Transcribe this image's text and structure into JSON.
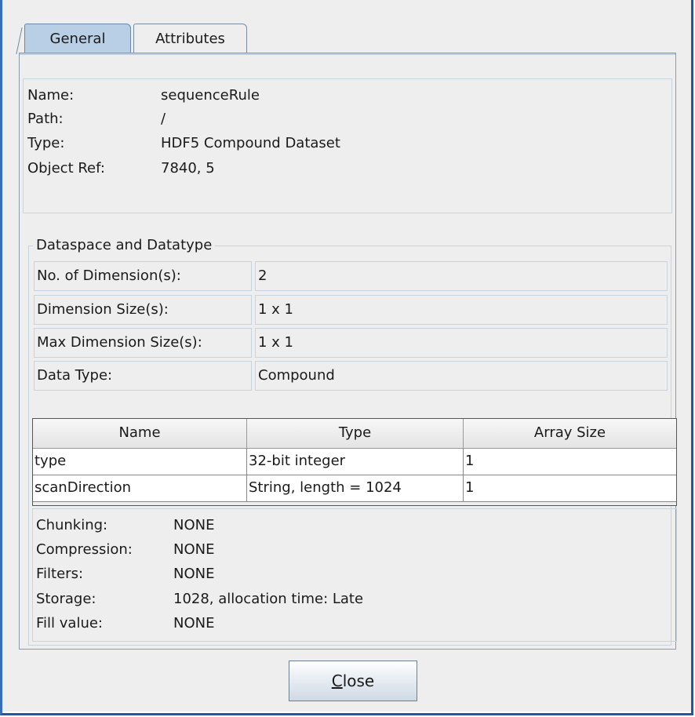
{
  "tabs": [
    {
      "label": "General",
      "selected": true
    },
    {
      "label": "Attributes",
      "selected": false
    }
  ],
  "general": {
    "name_label": "Name:",
    "name_value": "sequenceRule",
    "path_label": "Path:",
    "path_value": "/",
    "type_label": "Type:",
    "type_value": "HDF5 Compound Dataset",
    "ref_label": "Object Ref:",
    "ref_value": "7840, 5"
  },
  "dataspace": {
    "title": "Dataspace and Datatype",
    "rows": [
      {
        "label": "No. of Dimension(s):",
        "value": "2"
      },
      {
        "label": "Dimension Size(s):",
        "value": "1 x 1"
      },
      {
        "label": "Max Dimension Size(s):",
        "value": "1 x 1"
      },
      {
        "label": "Data Type:",
        "value": "Compound"
      }
    ]
  },
  "members_table": {
    "columns": [
      "Name",
      "Type",
      "Array Size"
    ],
    "rows": [
      [
        "type",
        "32-bit integer",
        "1"
      ],
      [
        "scanDirection",
        "String, length = 1024",
        "1"
      ]
    ]
  },
  "storage": {
    "rows": [
      {
        "label": "Chunking:",
        "value": "NONE"
      },
      {
        "label": "Compression:",
        "value": "NONE"
      },
      {
        "label": "Filters:",
        "value": "NONE"
      },
      {
        "label": "Storage:",
        "value": "1028, allocation time: Late"
      },
      {
        "label": "Fill value:",
        "value": "NONE"
      }
    ]
  },
  "close_button": {
    "mnemonic": "C",
    "rest": "lose"
  },
  "colors": {
    "window_border": "#1e59a8",
    "selected_tab": "#b8cfe5",
    "background": "#eeeeee"
  }
}
